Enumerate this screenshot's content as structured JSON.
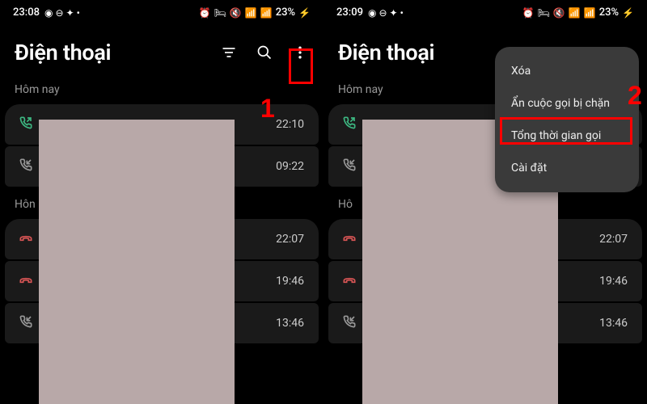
{
  "left": {
    "status": {
      "time": "23:08",
      "battery": "23%"
    },
    "title": "Điện thoại",
    "sections": [
      {
        "label": "Hôm nay",
        "calls": [
          {
            "type": "outgoing",
            "time": "22:10"
          },
          {
            "type": "incoming",
            "time": "09:22"
          }
        ]
      },
      {
        "label": "Hôn",
        "calls": [
          {
            "type": "missed",
            "time": "22:07"
          },
          {
            "type": "missed",
            "time": "19:46"
          },
          {
            "type": "incoming",
            "time": "13:46"
          }
        ]
      }
    ],
    "annotation": "1"
  },
  "right": {
    "status": {
      "time": "23:09",
      "battery": "23%"
    },
    "title": "Điện thoại",
    "sections": [
      {
        "label": "Hôm nay",
        "calls": [
          {
            "type": "outgoing",
            "time": ""
          },
          {
            "type": "incoming",
            "time": ""
          }
        ]
      },
      {
        "label": "Hô",
        "calls": [
          {
            "type": "missed",
            "time": "22:07"
          },
          {
            "type": "missed",
            "time": "19:46"
          },
          {
            "type": "incoming",
            "time": "13:46"
          }
        ]
      }
    ],
    "menu": {
      "items": [
        "Xóa",
        "Ẩn cuộc gọi bị chặn",
        "Tổng thời gian gọi",
        "Cài đặt"
      ]
    },
    "annotation": "2"
  }
}
